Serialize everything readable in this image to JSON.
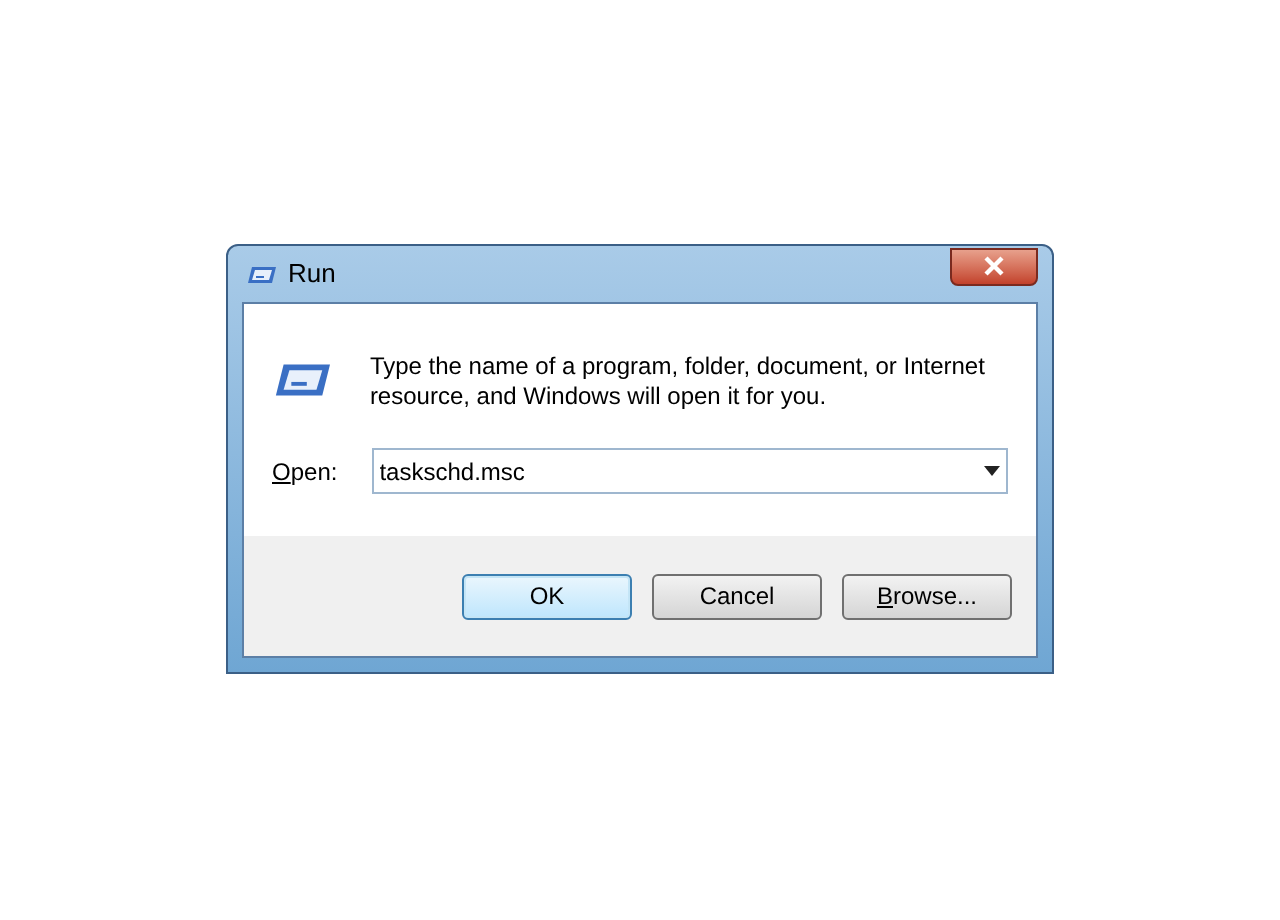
{
  "window": {
    "title": "Run"
  },
  "description": "Type the name of a program, folder, document, or Internet resource, and Windows will open it for you.",
  "open_field": {
    "label_mnemonic": "O",
    "label_rest": "pen:",
    "value": "taskschd.msc"
  },
  "buttons": [
    {
      "kind": "plain",
      "label": "OK",
      "default": true
    },
    {
      "kind": "plain",
      "label": "Cancel",
      "default": false
    },
    {
      "kind": "mnemonic",
      "label_mnemonic": "B",
      "label_rest": "rowse...",
      "default": false
    }
  ]
}
